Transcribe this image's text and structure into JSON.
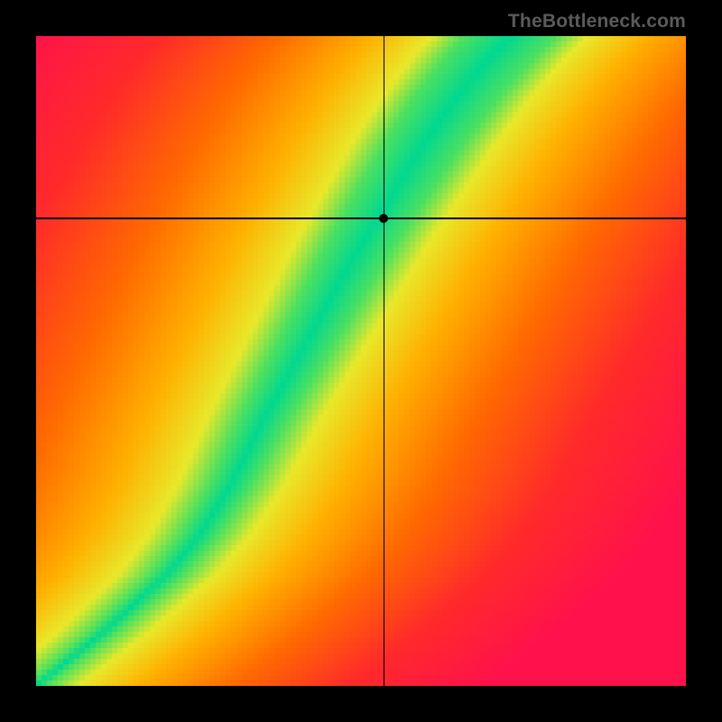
{
  "watermark": "TheBottleneck.com",
  "chart_data": {
    "type": "heatmap",
    "title": "",
    "xlabel": "",
    "ylabel": "",
    "xlim": [
      0,
      1
    ],
    "ylim": [
      0,
      1
    ],
    "grid_resolution": 120,
    "marker": {
      "x": 0.535,
      "y": 0.72
    },
    "crosshair": {
      "x": 0.535,
      "y": 0.72
    },
    "optimal_curve": {
      "description": "Green ridge of optimal match; origin at bottom-left",
      "points": [
        [
          0.0,
          0.0
        ],
        [
          0.1,
          0.08
        ],
        [
          0.2,
          0.17
        ],
        [
          0.25,
          0.23
        ],
        [
          0.3,
          0.31
        ],
        [
          0.35,
          0.41
        ],
        [
          0.4,
          0.5
        ],
        [
          0.45,
          0.59
        ],
        [
          0.5,
          0.68
        ],
        [
          0.55,
          0.76
        ],
        [
          0.6,
          0.84
        ],
        [
          0.65,
          0.91
        ],
        [
          0.7,
          0.97
        ],
        [
          0.73,
          1.0
        ]
      ]
    },
    "band_halfwidth": {
      "description": "Approx half-width of green band as fraction of x-axis, varies with y",
      "at_y_0": 0.015,
      "at_y_1": 0.07
    },
    "color_scale": {
      "description": "Deviation from optimal curve mapped to color",
      "stops": [
        {
          "dev": 0.0,
          "color": "#00d890"
        },
        {
          "dev": 0.05,
          "color": "#4be060"
        },
        {
          "dev": 0.12,
          "color": "#e8e82a"
        },
        {
          "dev": 0.25,
          "color": "#ffb000"
        },
        {
          "dev": 0.45,
          "color": "#ff6a00"
        },
        {
          "dev": 0.7,
          "color": "#ff2a2a"
        },
        {
          "dev": 1.0,
          "color": "#ff114c"
        }
      ]
    }
  }
}
